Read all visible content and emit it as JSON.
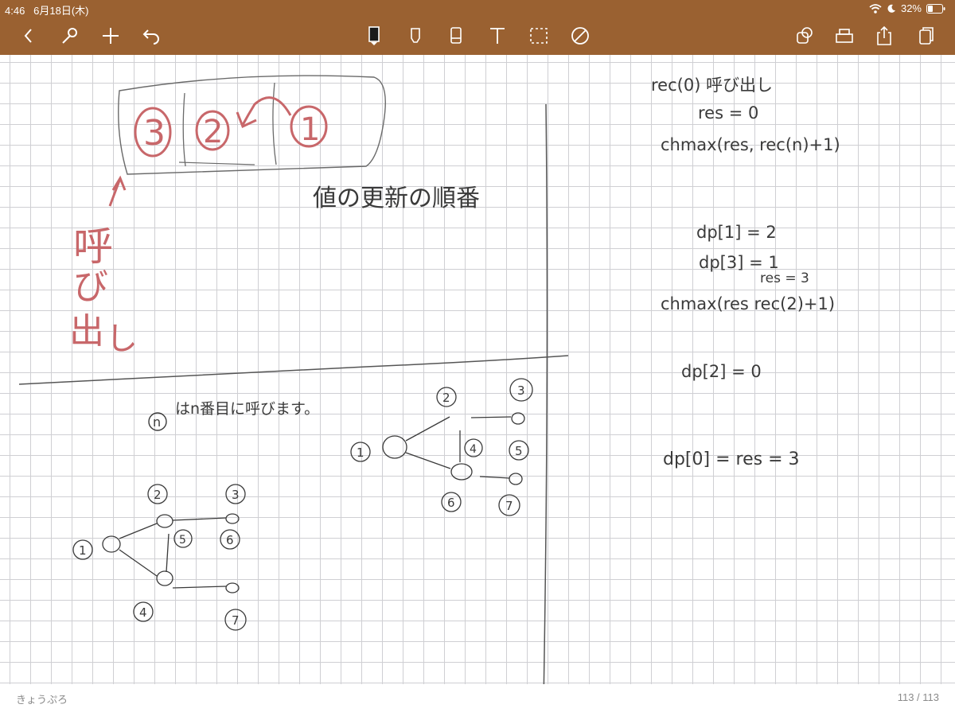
{
  "status_bar": {
    "time": "4:46",
    "date": "6月18日(木)",
    "battery": "32%"
  },
  "toolbar": {
    "left_icons": [
      "back-icon",
      "wrench-icon",
      "add-icon",
      "undo-icon"
    ],
    "center_tools": [
      "pen-icon",
      "highlighter-icon",
      "eraser-icon",
      "text-icon",
      "lasso-icon",
      "no-sign-icon"
    ],
    "right_icons": [
      "shapes-icon",
      "tray-icon",
      "share-icon",
      "pages-icon"
    ]
  },
  "colors": {
    "toolbar_bg": "#9a6131",
    "ink": "#3a3a3a",
    "red_ink": "#c8676a",
    "grid": "#cfcfd3"
  },
  "notes": {
    "red_circles": [
      "3",
      "2",
      "1"
    ],
    "red_vertical": [
      "呼",
      "び",
      "出",
      "し"
    ],
    "value_update_order": "値の更新の順番",
    "n_called_note": "はn番目に呼びます。",
    "n_symbol": "n",
    "graph_left_nodes": [
      "1",
      "2",
      "3",
      "4",
      "5",
      "6",
      "7"
    ],
    "graph_right_nodes": [
      "1",
      "2",
      "3",
      "4",
      "5",
      "6",
      "7"
    ],
    "right_lines": [
      "rec(0) 呼び出し",
      "res = 0",
      "chmax(res, rec(n)+1)",
      "dp[1] = 2",
      "dp[3] = 1",
      "res = 3",
      "chmax(res  rec(2)+1)",
      "dp[2] = 0",
      "dp[0] = res = 3"
    ]
  },
  "footer": {
    "notebook_name": "きょうぷろ",
    "page_counter": "113 / 113"
  }
}
